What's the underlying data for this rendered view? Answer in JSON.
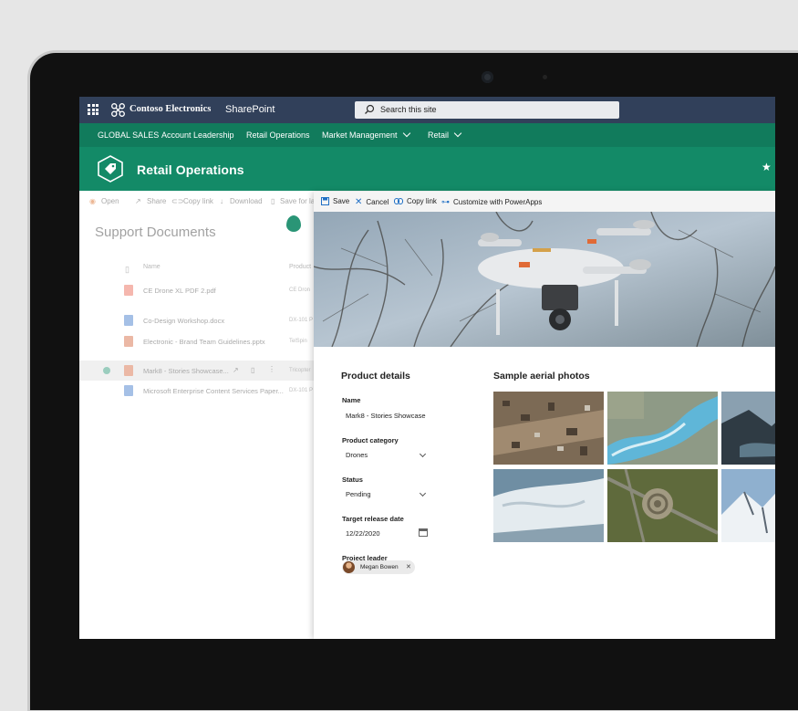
{
  "suite": {
    "brand": "Contoso Electronics",
    "app": "SharePoint",
    "search_placeholder": "Search this site"
  },
  "hub_nav": [
    "GLOBAL SALES",
    "Account Leadership",
    "Retail Operations",
    "Market Management",
    "Retail"
  ],
  "site": {
    "title": "Retail Operations"
  },
  "library": {
    "commands": [
      "Open",
      "Share",
      "Copy link",
      "Download",
      "Save for la"
    ],
    "title": "Support Documents",
    "columns": [
      "Name",
      "Product"
    ],
    "files": [
      {
        "name": "CE Drone XL PDF 2.pdf",
        "product": "CE Dron"
      },
      {
        "name": "Co-Design Workshop.docx",
        "product": "DX-101 P"
      },
      {
        "name": "Electronic - Brand Team Guidelines.pptx",
        "product": "TelSpin"
      },
      {
        "name": "Mark8 - Stories Showcase...",
        "product": "Tricopter"
      },
      {
        "name": "Microsoft Enterprise Content Services Paper...",
        "product": "DX-101 P"
      }
    ]
  },
  "panel": {
    "commands": [
      "Save",
      "Cancel",
      "Copy link",
      "Customize with PowerApps"
    ],
    "details_title": "Product details",
    "photos_title": "Sample aerial photos",
    "fields": {
      "name_label": "Name",
      "name_value": "Mark8 - Stories Showcase",
      "category_label": "Product category",
      "category_value": "Drones",
      "status_label": "Status",
      "status_value": "Pending",
      "date_label": "Target release date",
      "date_value": "12/22/2020",
      "leader_label": "Project leader",
      "leader_value": "Megan Bowen"
    }
  },
  "colors": {
    "suite_bar": "#31405a",
    "hub_nav": "#117b5c",
    "site_header": "#138a67",
    "accent_blue": "#1f6fc5"
  }
}
